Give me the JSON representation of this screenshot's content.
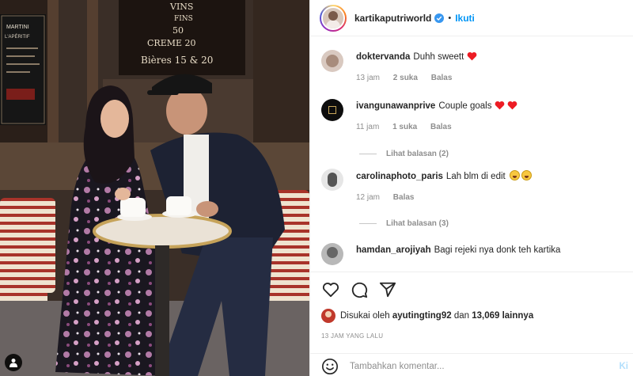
{
  "post": {
    "username": "kartikaputriworld",
    "follow_label": "Ikuti",
    "separator": "•"
  },
  "photo": {
    "sign_lines": [
      "VINS",
      "FINS",
      "50",
      "CREME 20",
      "Bières 15 & 20"
    ],
    "menu_lines": [
      "MARTINI",
      "L'APÉRITIF"
    ]
  },
  "comments": [
    {
      "username": "doktervanda",
      "text": "Duhh sweett",
      "emoji": "heart",
      "time": "13 jam",
      "likes": "2 suka",
      "reply": "Balas"
    },
    {
      "username": "ivangunawanprive",
      "text": "Couple goals",
      "emoji": "hearts",
      "time": "11 jam",
      "likes": "1 suka",
      "reply": "Balas",
      "view_replies": "Lihat balasan (2)"
    },
    {
      "username": "carolinaphoto_paris",
      "text": "Lah blm di edit",
      "emoji": "laugh",
      "time": "12 jam",
      "reply": "Balas",
      "view_replies": "Lihat balasan (3)"
    },
    {
      "username": "hamdan_arojiyah",
      "text": "Bagi rejeki nya donk teh kartika"
    }
  ],
  "likes": {
    "prefix": "Disukai oleh",
    "user": "ayutingting92",
    "conj": "dan",
    "others": "13,069 lainnya"
  },
  "timestamp": "13 JAM YANG LALU",
  "add_comment": {
    "placeholder": "Tambahkan komentar...",
    "post_label": "Ki"
  },
  "icons": {
    "like": "heart-outline-icon",
    "comment": "comment-bubble-icon",
    "share": "paper-plane-icon"
  },
  "colors": {
    "accent_blue": "#0095f6",
    "heart_red": "#ed1c24",
    "text_primary": "#262626",
    "text_secondary": "#8e8e8e"
  }
}
